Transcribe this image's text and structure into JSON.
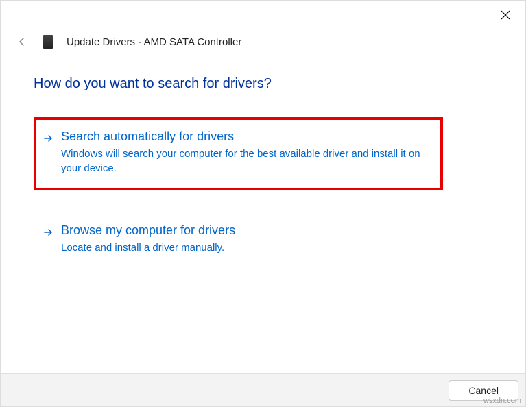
{
  "header": {
    "title": "Update Drivers - AMD SATA Controller"
  },
  "question": "How do you want to search for drivers?",
  "options": [
    {
      "title": "Search automatically for drivers",
      "description": "Windows will search your computer for the best available driver and install it on your device."
    },
    {
      "title": "Browse my computer for drivers",
      "description": "Locate and install a driver manually."
    }
  ],
  "footer": {
    "cancel_label": "Cancel"
  },
  "watermark": "wsxdn.com"
}
